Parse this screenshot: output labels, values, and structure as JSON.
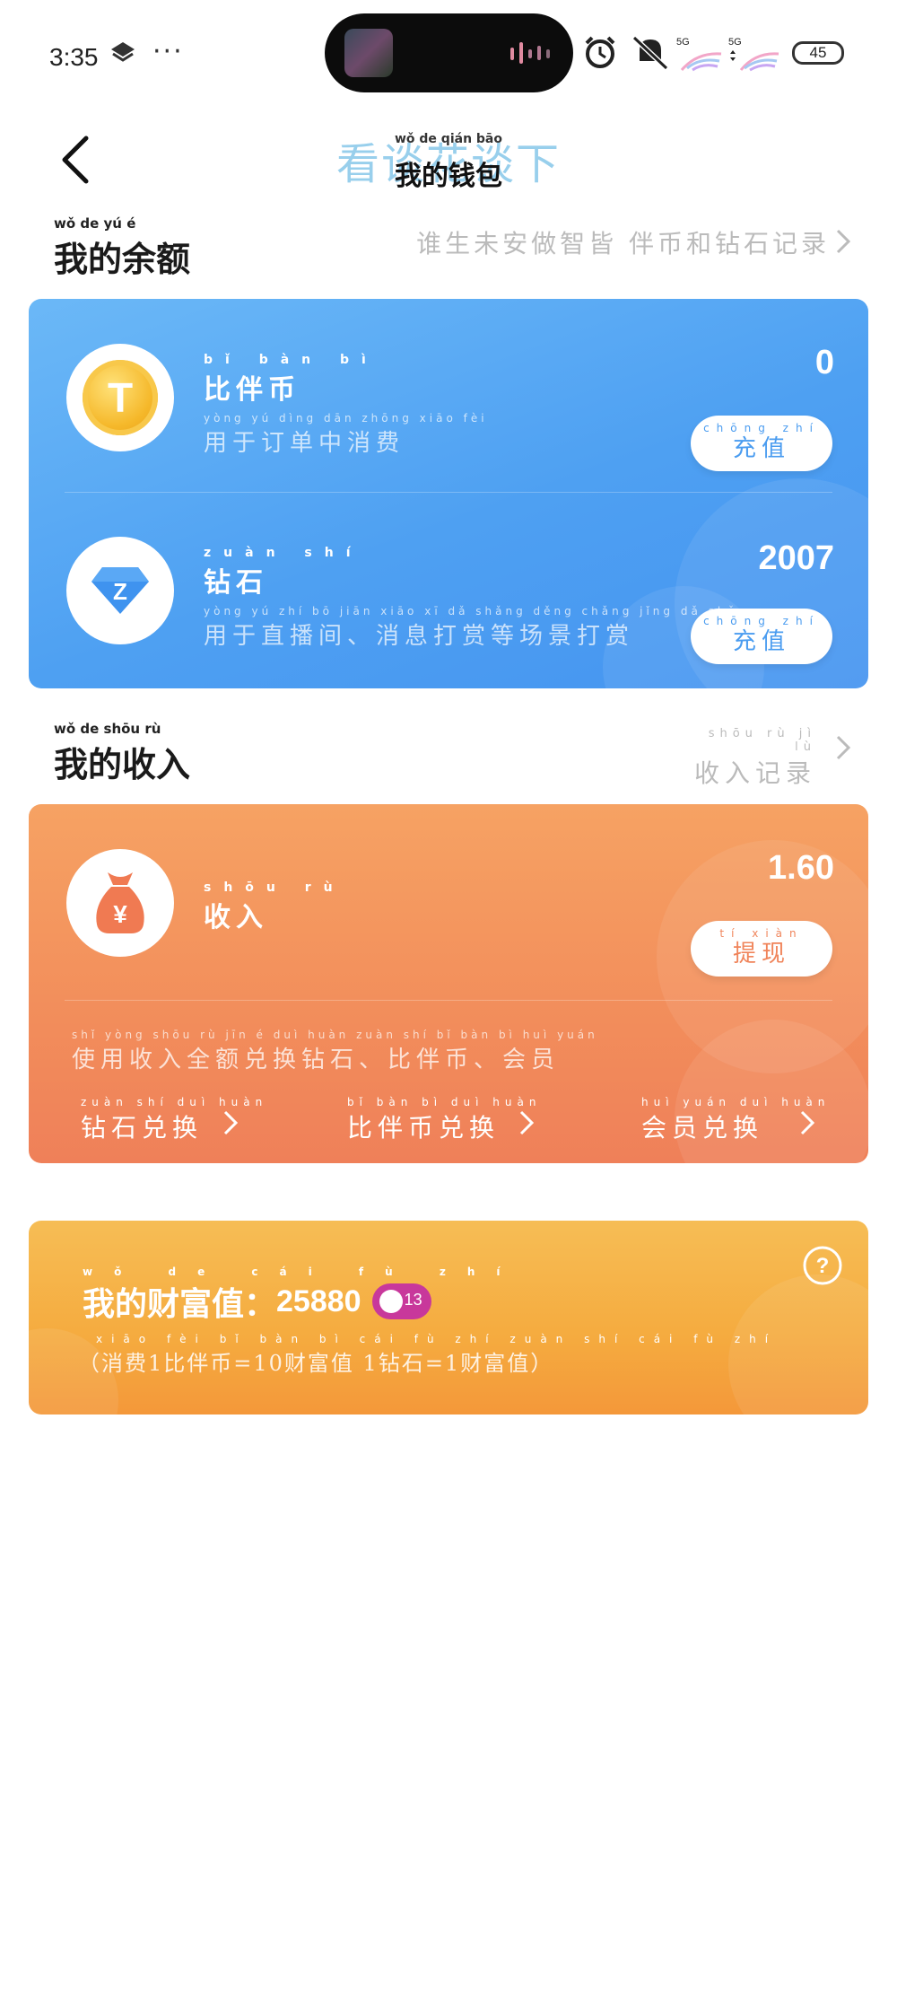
{
  "status_bar": {
    "time": "3:35",
    "more": "···",
    "signal1": "5G",
    "signal2": "5G",
    "battery": "45"
  },
  "header": {
    "title": "我的钱包",
    "title_pinyin": "wǒ de qián bāo",
    "title_overlay": "看谈花谈下"
  },
  "balance_section": {
    "title": "我的余额",
    "title_pinyin": "wǒ de yú é",
    "link": "谁生未安做智皆 伴币和钻石记录",
    "items": [
      {
        "icon_label": "T",
        "name": "比伴币",
        "name_pinyin": "bǐ bàn bì",
        "desc": "用于订单中消费",
        "desc_pinyin": "yòng yú dìng dān zhōng xiāo fèi",
        "amount": "0",
        "button": "充值",
        "button_pinyin": "chōng zhí"
      },
      {
        "icon_label": "Z",
        "name": "钻石",
        "name_pinyin": "zuàn shí",
        "desc": "用于直播间、消息打赏等场景打赏",
        "desc_pinyin": "yòng yú zhí bō jiān xiāo xī dǎ shǎng děng chǎng jǐng dǎ shǎng",
        "amount": "2007",
        "button": "充值",
        "button_pinyin": "chōng zhí"
      }
    ]
  },
  "income_section": {
    "title": "我的收入",
    "title_pinyin": "wǒ de shōu rù",
    "link": "收入记录",
    "link_pinyin": "shōu rù jì lù",
    "name": "收入",
    "name_pinyin": "shōu rù",
    "amount": "1.60",
    "button": "提现",
    "button_pinyin": "tí xiàn",
    "note": "使用收入全额兑换钻石、比伴币、会员",
    "note_pinyin": "shǐ yòng shōu rù jīn é duì huàn zuàn shí bǐ bàn bì huì yuán",
    "exchanges": [
      {
        "label": "钻石兑换",
        "pinyin": "zuàn shí duì huàn"
      },
      {
        "label": "比伴币兑换",
        "pinyin": "bǐ bàn bì duì huàn"
      },
      {
        "label": "会员兑换",
        "pinyin": "huì yuán duì huàn"
      }
    ]
  },
  "wealth": {
    "label": "我的财富值：",
    "label_pinyin": "wǒ de cái fù zhí",
    "value": "25880",
    "level": "13",
    "note": "（消费1比伴币=10财富值 1钻石=1财富值）",
    "note_pinyin": "xiāo fèi bǐ bàn bì cái fù zhí zuàn shí cái fù zhí"
  },
  "colors": {
    "blue_card": "#4ea0f2",
    "orange_card": "#f28d5b",
    "gold_card": "#f5ab3f",
    "button_text_blue": "#4a9cf0",
    "button_text_orange": "#f0845a",
    "badge": "#c8389b"
  },
  "icons": [
    "layers-icon",
    "alarm-icon",
    "mute-icon",
    "signal-icon",
    "battery-icon",
    "back-icon",
    "chevron-right-icon",
    "coin-icon",
    "diamond-icon",
    "money-bag-icon",
    "help-icon"
  ]
}
